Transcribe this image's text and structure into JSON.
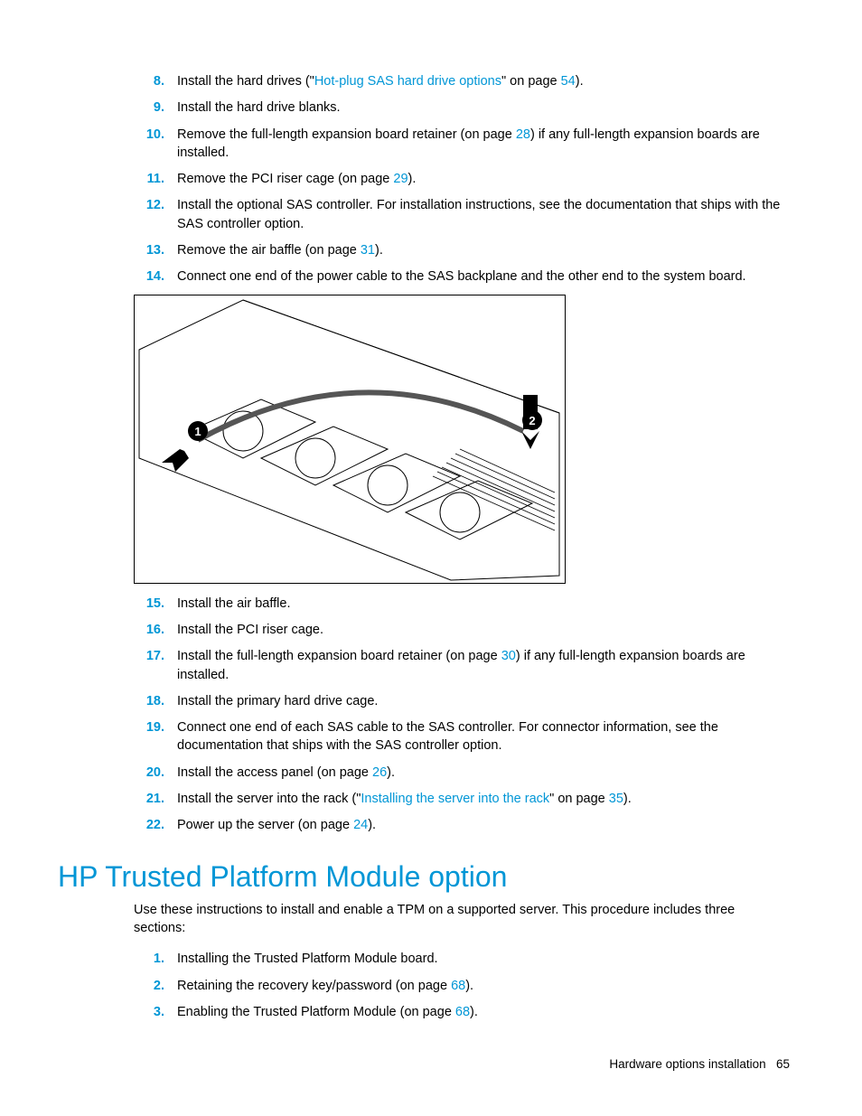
{
  "steps_top": [
    {
      "n": "8.",
      "pre": "Install the hard drives (\"",
      "link1": "Hot-plug SAS hard drive options",
      "mid": "\" on page ",
      "page": "54",
      "post": ")."
    },
    {
      "n": "9.",
      "text": "Install the hard drive blanks."
    },
    {
      "n": "10.",
      "pre": "Remove the full-length expansion board retainer (on page ",
      "page": "28",
      "post": ") if any full-length expansion boards are installed."
    },
    {
      "n": "11.",
      "pre": "Remove the PCI riser cage (on page ",
      "page": "29",
      "post": ")."
    },
    {
      "n": "12.",
      "text": "Install the optional SAS controller. For installation instructions, see the documentation that ships with the SAS controller option."
    },
    {
      "n": "13.",
      "pre": "Remove the air baffle (on page ",
      "page": "31",
      "post": ")."
    },
    {
      "n": "14.",
      "text": "Connect one end of the power cable to the SAS backplane and the other end to the system board."
    }
  ],
  "figure": {
    "callout1": "1",
    "callout2": "2"
  },
  "steps_bottom": [
    {
      "n": "15.",
      "text": "Install the air baffle."
    },
    {
      "n": "16.",
      "text": "Install the PCI riser cage."
    },
    {
      "n": "17.",
      "pre": "Install the full-length expansion board retainer (on page ",
      "page": "30",
      "post": ") if any full-length expansion boards are installed."
    },
    {
      "n": "18.",
      "text": "Install the primary hard drive cage."
    },
    {
      "n": "19.",
      "text": "Connect one end of each SAS cable to the SAS controller. For connector information, see the documentation that ships with the SAS controller option."
    },
    {
      "n": "20.",
      "pre": "Install the access panel (on page ",
      "page": "26",
      "post": ")."
    },
    {
      "n": "21.",
      "pre": "Install the server into the rack (\"",
      "link1": "Installing the server into the rack",
      "mid": "\" on page ",
      "page": "35",
      "post": ")."
    },
    {
      "n": "22.",
      "pre": "Power up the server (on page ",
      "page": "24",
      "post": ")."
    }
  ],
  "heading": "HP Trusted Platform Module option",
  "intro": "Use these instructions to install and enable a TPM on a supported server. This procedure includes three sections:",
  "steps_tpm": [
    {
      "n": "1.",
      "text": "Installing the Trusted Platform Module board."
    },
    {
      "n": "2.",
      "pre": "Retaining the recovery key/password (on page ",
      "page": "68",
      "post": ")."
    },
    {
      "n": "3.",
      "pre": "Enabling the Trusted Platform Module (on page ",
      "page": "68",
      "post": ")."
    }
  ],
  "footer": {
    "section": "Hardware options installation",
    "page": "65"
  }
}
